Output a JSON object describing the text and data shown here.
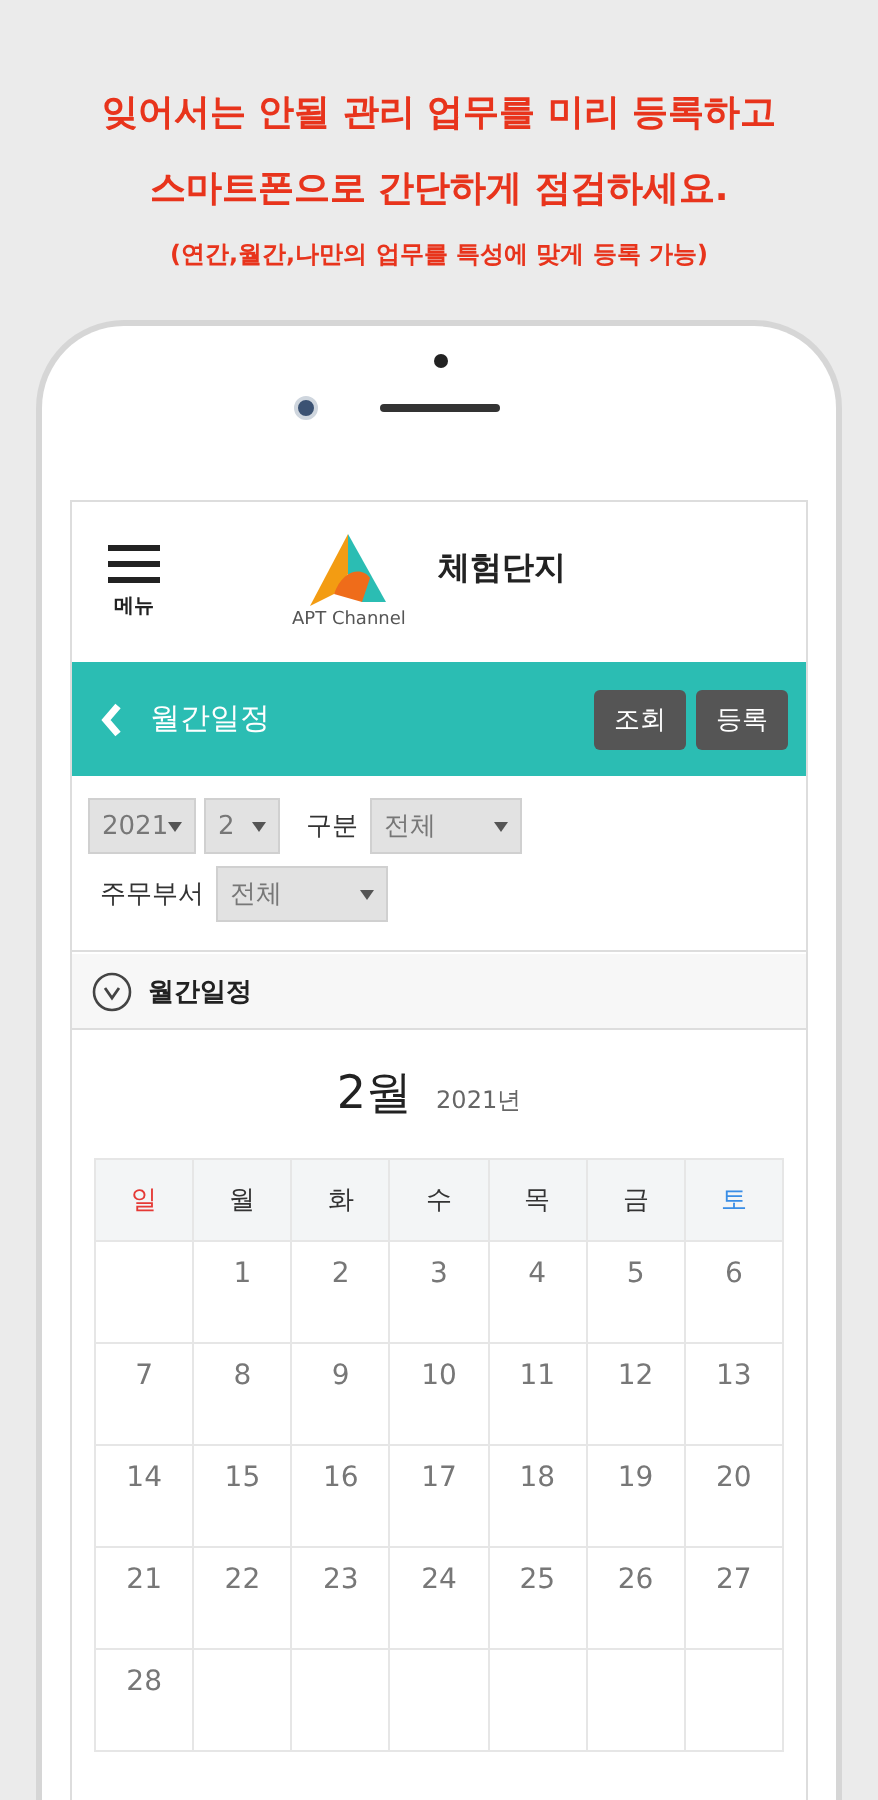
{
  "headline": {
    "lines": [
      "잊어서는 안될 관리 업무를 미리 등록하고",
      "스마트폰으로 간단하게 점검하세요."
    ],
    "note": "(연간,월간,나만의 업무를 특성에 맞게 등록 가능)"
  },
  "header": {
    "menu_label": "메뉴",
    "logo_text": "APT Channel",
    "title": "체험단지"
  },
  "title_bar": {
    "title": "월간일정",
    "buttons": [
      "조회",
      "등록"
    ]
  },
  "filters": {
    "year": "2021",
    "month": "2",
    "category_label": "구분",
    "category": "전체",
    "department_label": "주무부서",
    "department": "전체"
  },
  "section": {
    "title": "월간일정",
    "expanded": true
  },
  "calendar": {
    "month": "2월",
    "year": "2021년",
    "weekdays": [
      {
        "label": "일",
        "color": "#e53935"
      },
      {
        "label": "월",
        "color": "#333333"
      },
      {
        "label": "화",
        "color": "#333333"
      },
      {
        "label": "수",
        "color": "#333333"
      },
      {
        "label": "목",
        "color": "#333333"
      },
      {
        "label": "금",
        "color": "#333333"
      },
      {
        "label": "토",
        "color": "#3a8ee6"
      }
    ],
    "weeks": [
      [
        {
          "kind": "blank"
        },
        {
          "kind": "day",
          "day": "1"
        },
        {
          "kind": "day",
          "day": "2"
        },
        {
          "kind": "day",
          "day": "3"
        },
        {
          "kind": "day",
          "day": "4"
        },
        {
          "kind": "day",
          "day": "5"
        },
        {
          "kind": "day",
          "day": "6"
        }
      ],
      [
        {
          "kind": "day",
          "day": "7"
        },
        {
          "kind": "day",
          "day": "8"
        },
        {
          "kind": "day",
          "day": "9"
        },
        {
          "kind": "day",
          "day": "10"
        },
        {
          "kind": "day",
          "day": "11"
        },
        {
          "kind": "day",
          "day": "12"
        },
        {
          "kind": "day",
          "day": "13"
        }
      ],
      [
        {
          "kind": "day",
          "day": "14"
        },
        {
          "kind": "day",
          "day": "15"
        },
        {
          "kind": "day",
          "day": "16"
        },
        {
          "kind": "day",
          "day": "17"
        },
        {
          "kind": "day",
          "day": "18"
        },
        {
          "kind": "day",
          "day": "19"
        },
        {
          "kind": "day",
          "day": "20"
        }
      ],
      [
        {
          "kind": "day",
          "day": "21"
        },
        {
          "kind": "day",
          "day": "22"
        },
        {
          "kind": "day",
          "day": "23"
        },
        {
          "kind": "day",
          "day": "24"
        },
        {
          "kind": "day",
          "day": "25"
        },
        {
          "kind": "day",
          "day": "26"
        },
        {
          "kind": "day",
          "day": "27"
        }
      ],
      [
        {
          "kind": "day",
          "day": "28"
        },
        {
          "kind": "blank"
        },
        {
          "kind": "blank"
        },
        {
          "kind": "blank"
        },
        {
          "kind": "blank"
        },
        {
          "kind": "blank"
        },
        {
          "kind": "blank"
        }
      ]
    ]
  }
}
